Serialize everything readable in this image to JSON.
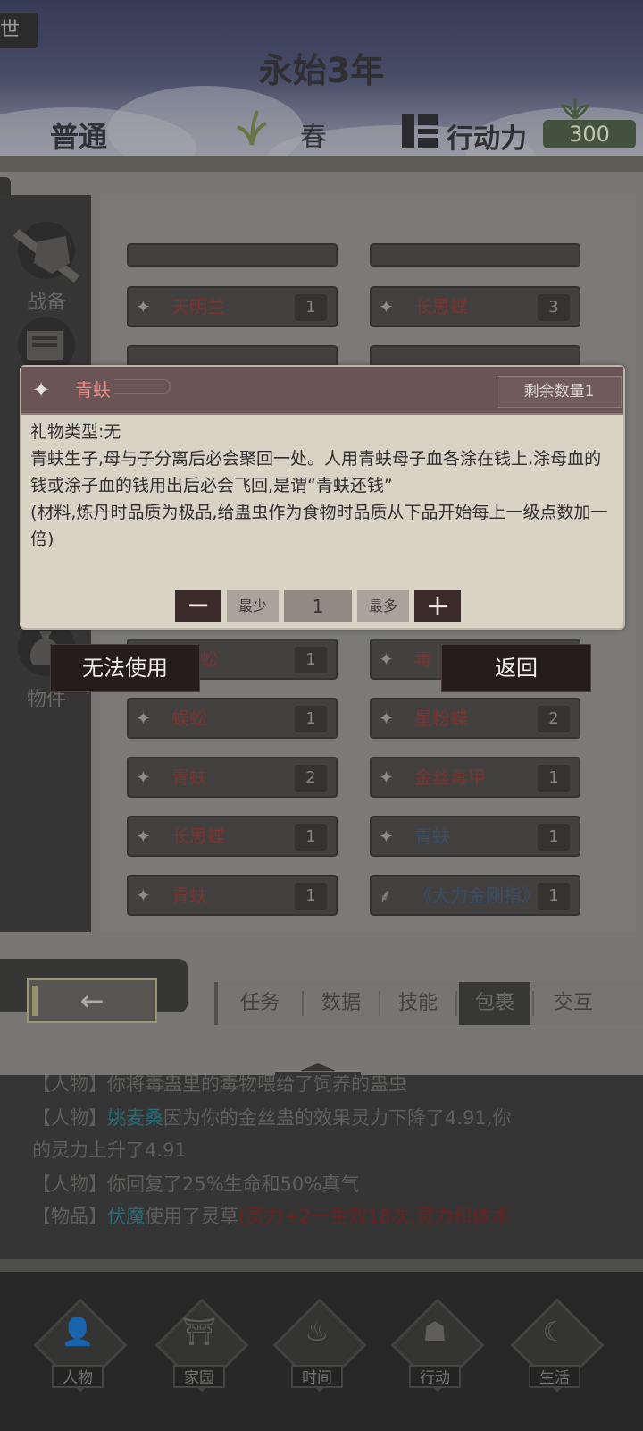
{
  "header": {
    "corner_tab": "世",
    "era": "永始3年",
    "difficulty": "普通",
    "season": "春",
    "action_label": "行动力",
    "action_points": "300"
  },
  "sidebar": {
    "items": [
      {
        "label": "战备",
        "icon": "sword-shield-icon"
      },
      {
        "label": "物件",
        "icon": "pouch-icon"
      }
    ]
  },
  "inventory": {
    "rows": [
      {
        "left": {
          "name": "天明兰",
          "count": "1"
        },
        "right": {
          "name": "长思蝶",
          "count": "3"
        }
      },
      {
        "left": {
          "name": "蚣",
          "count": "1"
        },
        "right": {
          "name": "毒",
          "count": ""
        }
      },
      {
        "left": {
          "name": "蜈蚣",
          "count": "1"
        },
        "right": {
          "name": "星粉蝶",
          "count": "2"
        }
      },
      {
        "left": {
          "name": "青蚨",
          "count": "2"
        },
        "right": {
          "name": "金丝毒甲",
          "count": "1"
        }
      },
      {
        "left": {
          "name": "长思蝶",
          "count": "1"
        },
        "right": {
          "name": "青蚨",
          "count": "1",
          "blue": true
        }
      },
      {
        "left": {
          "name": "青蚨",
          "count": "1"
        },
        "right": {
          "name": "《大力金刚指》",
          "count": "1",
          "blue": true
        }
      }
    ]
  },
  "tabs": [
    "任务",
    "数据",
    "技能",
    "包裹",
    "交互"
  ],
  "active_tab": "包裹",
  "log": {
    "line0": "【人物】你将毒蛊里的毒物喂给了饲养的蛊虫",
    "line1_prefix": "【人物】",
    "line1_name": "姚麦桑",
    "line1_text": "因为你的金丝蛊的效果灵力下降了4.91,你",
    "line2": "的灵力上升了4.91",
    "line3": "【人物】你回复了25%生命和50%真气",
    "line4_prefix": "【物品】",
    "line4_name": "伏魔",
    "line4_text": "使用了灵草",
    "line4_effect": "(灵力+2一生效18次,灵力和体术"
  },
  "bottom_nav": [
    "人物",
    "家园",
    "时间",
    "行动",
    "生活"
  ],
  "popup": {
    "item_name": "青蚨",
    "remaining": "剩余数量1",
    "gift_type": "礼物类型:无",
    "description": "青蚨生子,母与子分离后必会聚回一处。人用青蚨母子血各涂在钱上,涂母血的钱或涂子血的钱用出后必会飞回,是谓“青蚨还钱”",
    "note": "(材料,炼丹时品质为极品,给蛊虫作为食物时品质从下品开始每上一级点数加一倍)",
    "minus": "−",
    "min_label": "最少",
    "quantity": "1",
    "max_label": "最多",
    "plus": "+",
    "cannot_use": "无法使用",
    "return": "返回"
  },
  "colors": {
    "item_name_red": "#8e3b36",
    "item_name_blue": "#42597a",
    "log_highlight_cyan": "#2f7d8b",
    "popup_header": "#6a5455"
  }
}
